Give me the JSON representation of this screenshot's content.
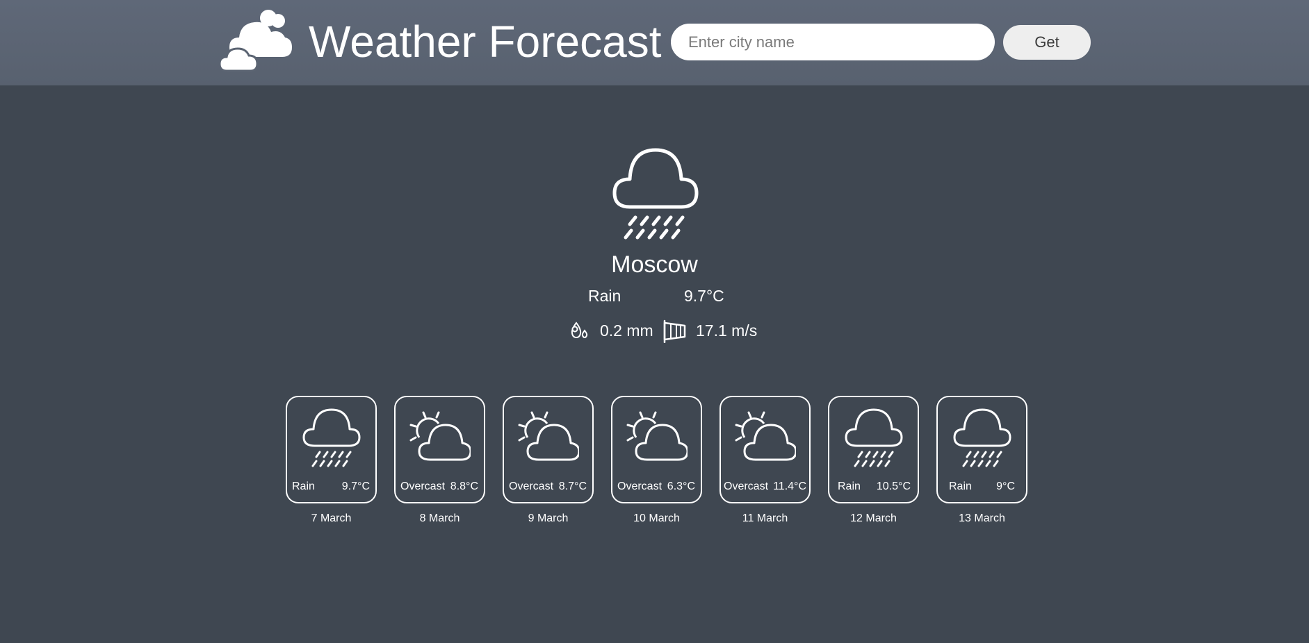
{
  "header": {
    "title": "Weather Forecast",
    "logo_icon": "clouds-logo-icon",
    "search_placeholder": "Enter city name",
    "search_value": "",
    "get_label": "Get"
  },
  "current": {
    "icon": "rain-icon",
    "city": "Moscow",
    "condition": "Rain",
    "temperature": "9.7°C",
    "precip_icon": "precipitation-icon",
    "precipitation": "0.2 mm",
    "wind_icon": "windsock-icon",
    "wind": "17.1 m/s"
  },
  "forecast": [
    {
      "icon": "rain-icon",
      "condition": "Rain",
      "temperature": "9.7°C",
      "date": "7 March"
    },
    {
      "icon": "overcast-icon",
      "condition": "Overcast",
      "temperature": "8.8°C",
      "date": "8 March"
    },
    {
      "icon": "overcast-icon",
      "condition": "Overcast",
      "temperature": "8.7°C",
      "date": "9 March"
    },
    {
      "icon": "overcast-icon",
      "condition": "Overcast",
      "temperature": "6.3°C",
      "date": "10 March"
    },
    {
      "icon": "overcast-icon",
      "condition": "Overcast",
      "temperature": "11.4°C",
      "date": "11 March"
    },
    {
      "icon": "rain-icon",
      "condition": "Rain",
      "temperature": "10.5°C",
      "date": "12 March"
    },
    {
      "icon": "rain-icon",
      "condition": "Rain",
      "temperature": "9°C",
      "date": "13 March"
    }
  ],
  "colors": {
    "background": "#3f4751",
    "header": "#5b6472",
    "text": "#ffffff",
    "button": "#eeeeee"
  }
}
